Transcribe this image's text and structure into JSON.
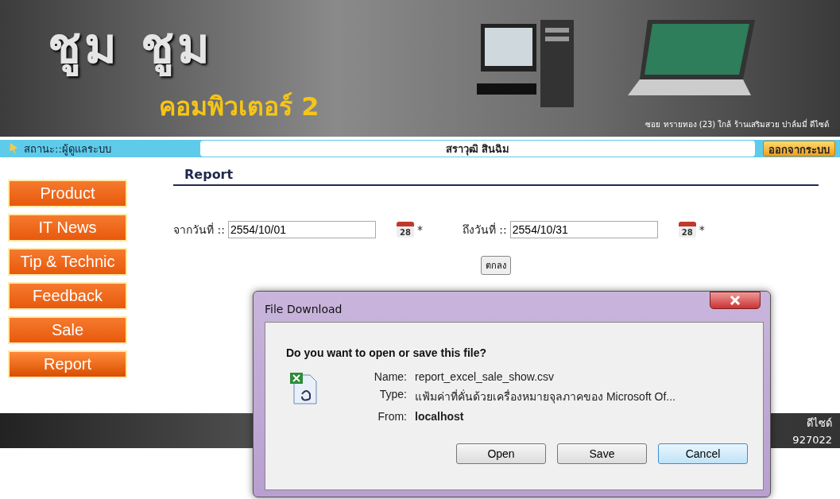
{
  "banner": {
    "logo_top": "ชูม ชูม",
    "logo_bottom": "คอมพิวเตอร์ 2",
    "address": "ซอย ทรายทอง (23) ใกล้ ร้านเสริมสวย ปาล์มมี่ ดีไซด์"
  },
  "status_bar": {
    "role": "สถานะ::ผู้ดูแลระบบ",
    "user": "สราวุฒิ  สินฉิม",
    "logout": "ออกจากระบบ"
  },
  "menu": [
    {
      "label": "Product",
      "selected": false
    },
    {
      "label": "IT News",
      "selected": false
    },
    {
      "label": "Tip & Technic",
      "selected": false
    },
    {
      "label": "Feedback",
      "selected": false
    },
    {
      "label": "Sale",
      "selected": false
    },
    {
      "label": "Report",
      "selected": true
    }
  ],
  "report": {
    "title": "Report",
    "from_label": "จากวันที่ ::",
    "from_value": "2554/10/01",
    "to_label": "ถึงวันที่ ::",
    "to_value": "2554/10/31",
    "from_calendar_day": "28",
    "to_calendar_day": "28",
    "required": "*",
    "submit": "ตกลง"
  },
  "footer": {
    "line_1": "ดีไซด์",
    "line_2": "927022"
  },
  "dialog": {
    "title": "File Download",
    "question": "Do you want to open or save this file?",
    "fields": [
      {
        "label": "Name:",
        "value": "report_excel_sale_show.csv",
        "bold": false
      },
      {
        "label": "Type:",
        "value": "แฟ้มค่าที่คั่นด้วยเครื่องหมายจุลภาคของ Microsoft Of...",
        "bold": false
      },
      {
        "label": "From:",
        "value": "localhost",
        "bold": true
      }
    ],
    "buttons": [
      {
        "label": "Open",
        "selected": false
      },
      {
        "label": "Save",
        "selected": false
      },
      {
        "label": "Cancel",
        "selected": true
      }
    ]
  }
}
